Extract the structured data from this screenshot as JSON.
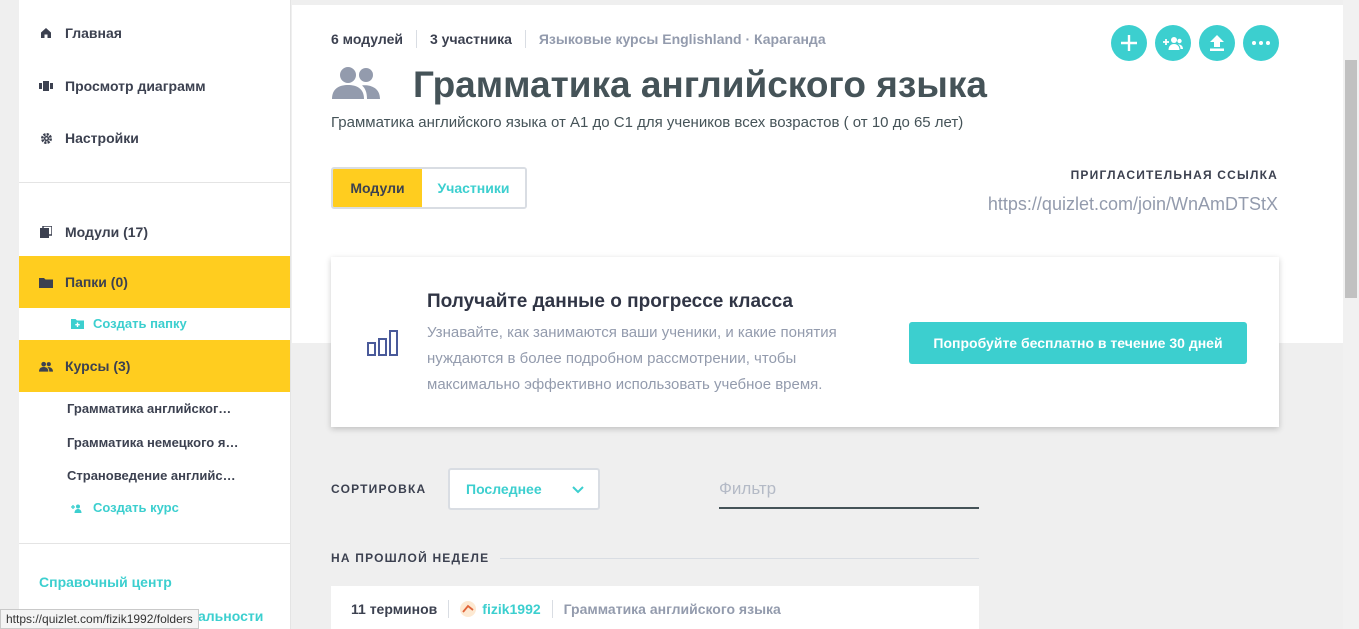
{
  "sidebar": {
    "nav": [
      {
        "label": "Главная",
        "icon": "home-icon"
      },
      {
        "label": "Просмотр диаграмм",
        "icon": "diagram-icon"
      },
      {
        "label": "Настройки",
        "icon": "gear-icon"
      }
    ],
    "library": {
      "modules": "Модули (17)",
      "folders": "Папки (0)",
      "create_folder": "Создать папку",
      "courses": "Курсы (3)",
      "course_items": [
        "Грамматика английского языка",
        "Грамматика немецкого языка",
        "Страноведение английского языка"
      ],
      "create_course": "Создать курс"
    },
    "help": "Справочный центр",
    "privacy_partial": "альности"
  },
  "status_url": "https://quizlet.com/fizik1992/folders",
  "class": {
    "modules_count": "6 модулей",
    "members_count": "3 участника",
    "organization": "Языковые курсы Englishland · Караганда",
    "title": "Грамматика английского языка",
    "description": "Грамматика английского языка от А1 до С1 для учеников всех возрастов ( от 10 до 65 лет)"
  },
  "tabs": [
    {
      "label": "Модули",
      "active": true
    },
    {
      "label": "Участники",
      "active": false
    }
  ],
  "invite": {
    "label": "ПРИГЛАСИТЕЛЬНАЯ ССЫЛКА",
    "link": "https://quizlet.com/join/WnAmDTStX"
  },
  "promo": {
    "title": "Получайте данные о прогрессе класса",
    "text": "Узнавайте, как занимаются ваши ученики, и какие понятия нуждаются в более подробном рассмотрении, чтобы максимально эффективно использовать учебное время.",
    "button": "Попробуйте бесплатно в течение 30 дней"
  },
  "sort": {
    "label": "СОРТИРОВКА",
    "selected": "Последнее"
  },
  "filter": {
    "placeholder": "Фильтр"
  },
  "section_label": "НА ПРОШЛОЙ НЕДЕЛЕ",
  "set": {
    "terms": "11 терминов",
    "user": "fizik1992",
    "class_name": "Грамматика английского языка"
  },
  "colors": {
    "accent": "#3ccfcf",
    "highlight": "#ffcd1f",
    "text": "#3c4150",
    "muted": "#939bad"
  }
}
